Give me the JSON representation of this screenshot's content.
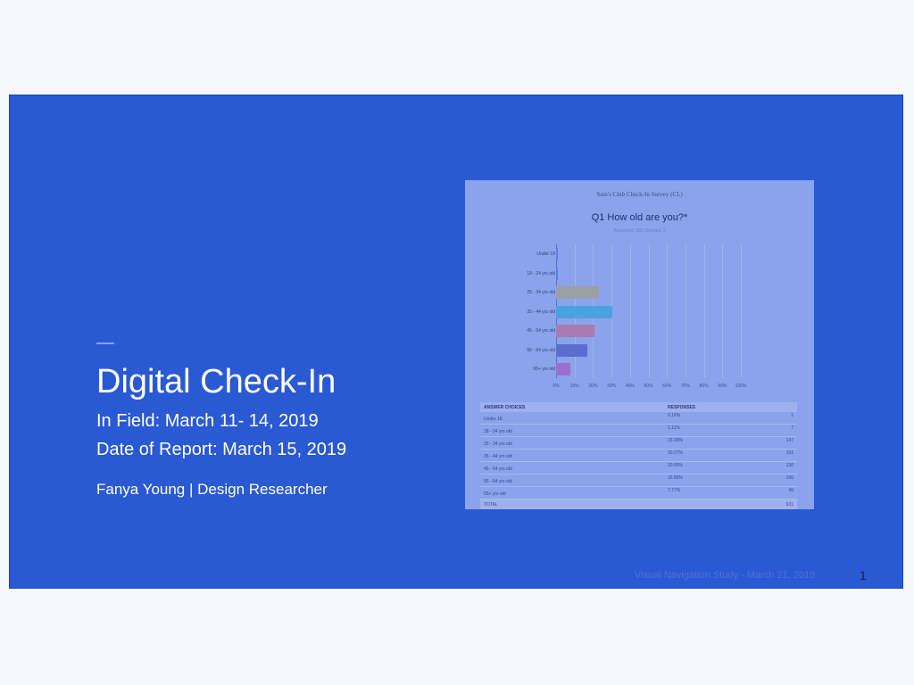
{
  "slide": {
    "title": "Digital Check-In",
    "in_field": "In Field:  March 11- 14, 2019",
    "report_date": "Date of Report:  March 15, 2019",
    "author": "Fanya Young | Design Researcher",
    "footer": "Visual Navigation Study - March 21, 2019",
    "page_number": "1",
    "colors": {
      "background": "#2a59d4",
      "accent_line": "#78a6ff",
      "text": "#ffffff"
    }
  },
  "survey": {
    "survey_title": "Sam's Club Check-In Survey (CL)",
    "question": "Q1 How old are you?*",
    "answered_skipped": "Answered: 631    Skipped: 3",
    "chart_data": {
      "type": "bar",
      "orientation": "horizontal",
      "categories": [
        "Under 18",
        "18 - 24 yrs old",
        "25 - 34 yrs old",
        "35 - 44 yrs old",
        "45 - 54 yrs old",
        "55 - 64 yrs old",
        "65+ yrs old"
      ],
      "values": [
        0.16,
        1.11,
        23.3,
        30.27,
        20.6,
        16.8,
        7.77
      ],
      "colors": [
        "#5a7ee0",
        "#5a7ee0",
        "#9aa0a6",
        "#4aa3e0",
        "#a97bb0",
        "#5c6dd0",
        "#9b6fcf"
      ],
      "x_ticks": [
        "0%",
        "10%",
        "20%",
        "30%",
        "40%",
        "50%",
        "60%",
        "70%",
        "80%",
        "90%",
        "100%"
      ],
      "xlim": [
        0,
        100
      ]
    },
    "table": {
      "headers": [
        "ANSWER CHOICES",
        "RESPONSES"
      ],
      "rows": [
        {
          "choice": "Under 18",
          "percent": "0.16%",
          "count": "1"
        },
        {
          "choice": "18 - 24 yrs old",
          "percent": "1.11%",
          "count": "7"
        },
        {
          "choice": "25 - 34 yrs old",
          "percent": "23.30%",
          "count": "147"
        },
        {
          "choice": "35 - 44 yrs old",
          "percent": "30.27%",
          "count": "191"
        },
        {
          "choice": "45 - 54 yrs old",
          "percent": "20.60%",
          "count": "130"
        },
        {
          "choice": "55 - 64 yrs old",
          "percent": "16.80%",
          "count": "106"
        },
        {
          "choice": "65+ yrs old",
          "percent": "7.77%",
          "count": "49"
        }
      ],
      "total_label": "TOTAL",
      "total_value": "631"
    }
  }
}
